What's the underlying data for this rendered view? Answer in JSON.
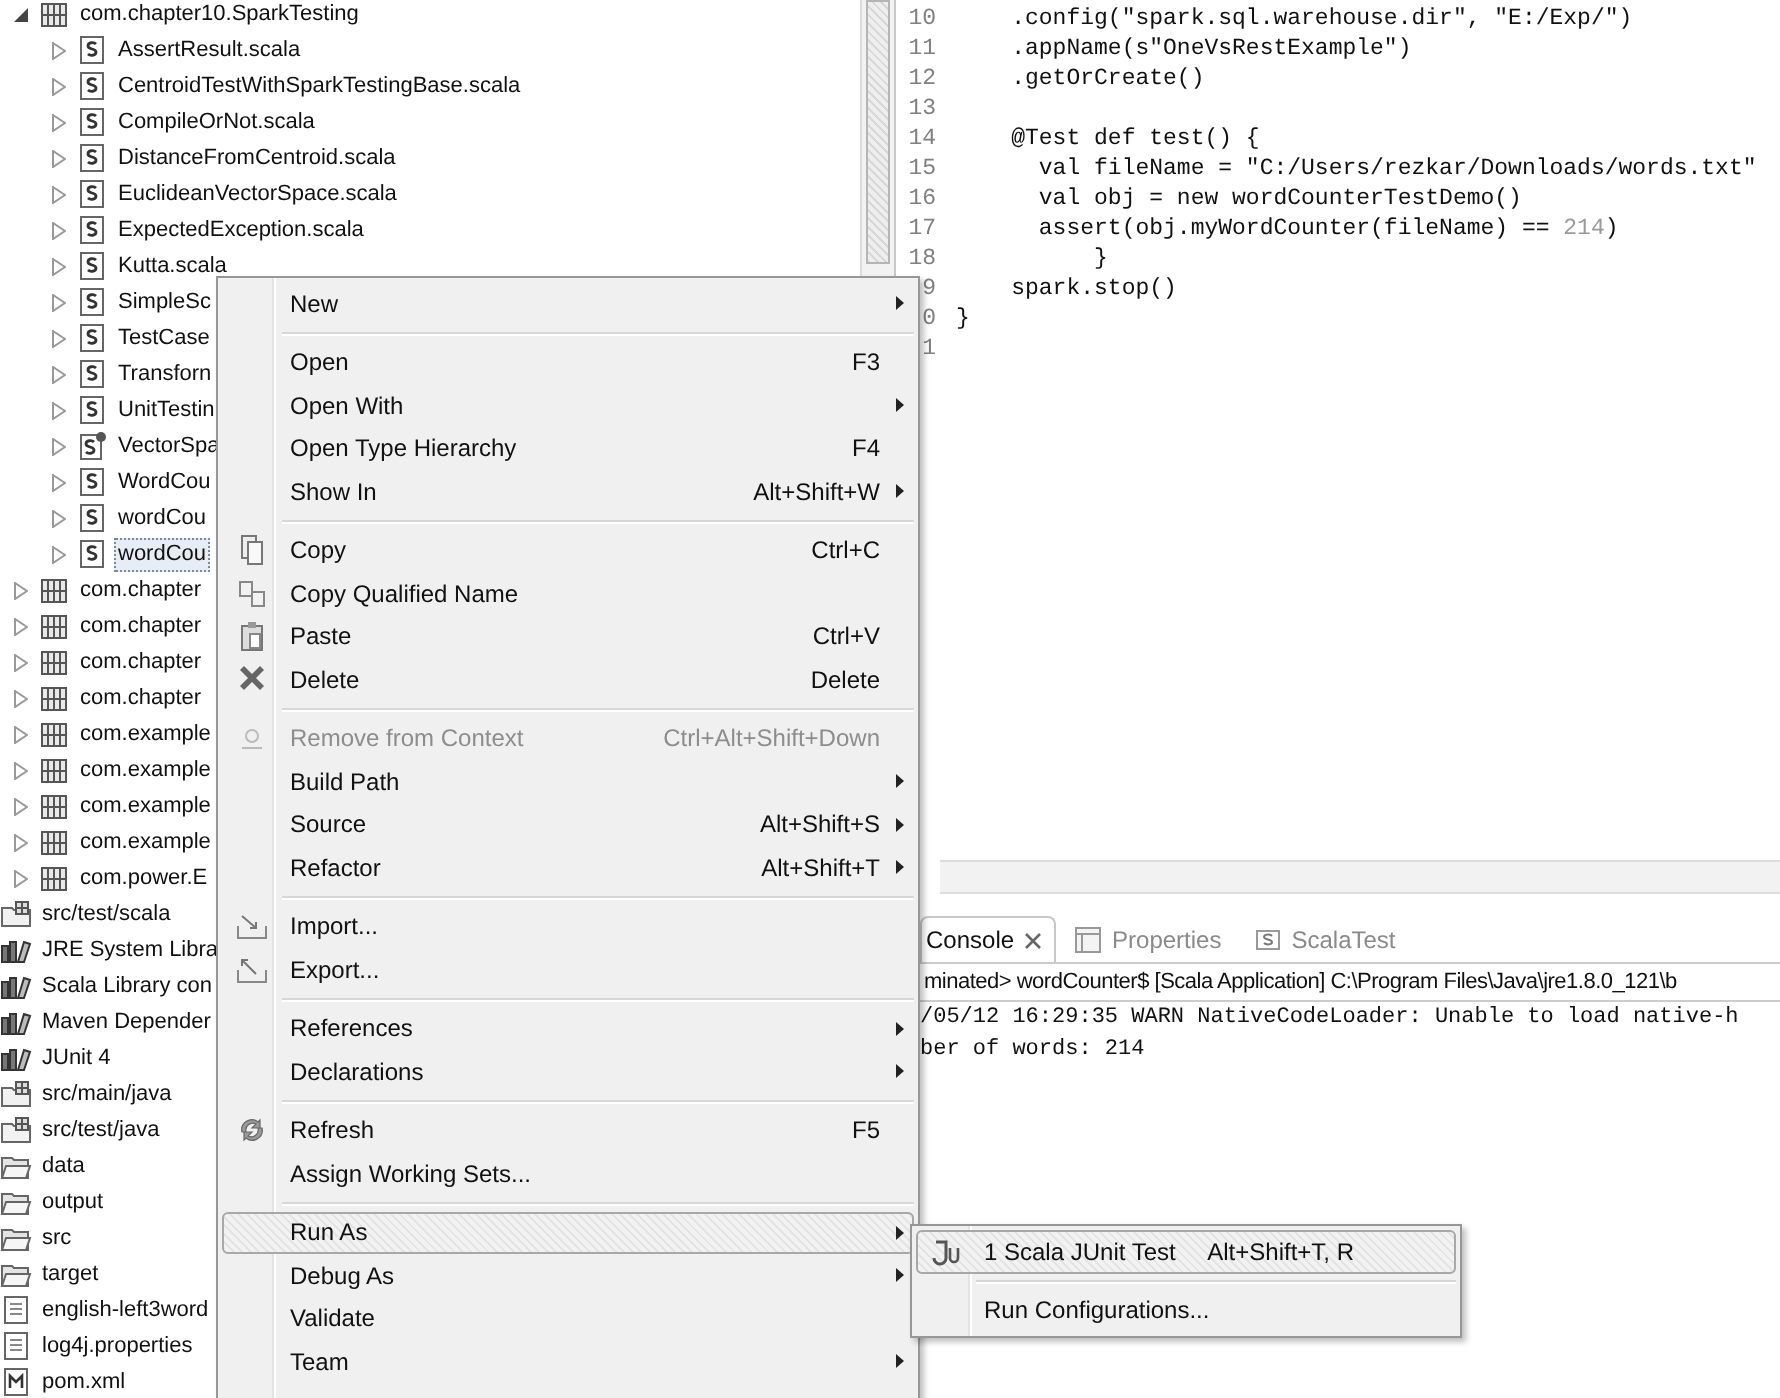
{
  "tree": {
    "upper_items": [
      {
        "label": "com.chapter10.SparkTesting",
        "kind": "package",
        "expanded": true,
        "selected": false,
        "children": [
          {
            "label": "AssertResult.scala",
            "kind": "scala_file",
            "expanded": false,
            "selected": false
          },
          {
            "label": "CentroidTestWithSparkTestingBase.scala",
            "kind": "scala_file",
            "expanded": false,
            "selected": false
          },
          {
            "label": "CompileOrNot.scala",
            "kind": "scala_file",
            "expanded": false,
            "selected": false
          },
          {
            "label": "DistanceFromCentroid.scala",
            "kind": "scala_file",
            "expanded": false,
            "selected": false
          },
          {
            "label": "EuclideanVectorSpace.scala",
            "kind": "scala_file",
            "expanded": false,
            "selected": false
          },
          {
            "label": "ExpectedException.scala",
            "kind": "scala_file",
            "expanded": false,
            "selected": false
          },
          {
            "label": "Kutta.scala",
            "kind": "scala_file",
            "expanded": false,
            "selected": false
          },
          {
            "label": "SimpleSc",
            "kind": "scala_file",
            "expanded": false,
            "selected": false
          },
          {
            "label": "TestCase",
            "kind": "scala_file",
            "expanded": false,
            "selected": false
          },
          {
            "label": "Transforn",
            "kind": "scala_file",
            "expanded": false,
            "selected": false
          },
          {
            "label": "UnitTestin",
            "kind": "scala_file",
            "expanded": false,
            "selected": false
          },
          {
            "label": "VectorSpa",
            "kind": "scala_object",
            "expanded": false,
            "selected": false
          },
          {
            "label": "WordCou",
            "kind": "scala_file",
            "expanded": false,
            "selected": false
          },
          {
            "label": "wordCou",
            "kind": "scala_file",
            "expanded": false,
            "selected": false
          },
          {
            "label": "wordCou",
            "kind": "scala_file",
            "expanded": false,
            "selected": true
          }
        ]
      },
      {
        "label": "com.chapter",
        "kind": "package",
        "expanded": false,
        "selected": false
      },
      {
        "label": "com.chapter",
        "kind": "package",
        "expanded": false,
        "selected": false
      },
      {
        "label": "com.chapter",
        "kind": "package",
        "expanded": false,
        "selected": false
      },
      {
        "label": "com.chapter",
        "kind": "package",
        "expanded": false,
        "selected": false
      },
      {
        "label": "com.example",
        "kind": "package",
        "expanded": false,
        "selected": false
      },
      {
        "label": "com.example",
        "kind": "package",
        "expanded": false,
        "selected": false
      },
      {
        "label": "com.example",
        "kind": "package",
        "expanded": false,
        "selected": false
      },
      {
        "label": "com.example",
        "kind": "package",
        "expanded": false,
        "selected": false
      },
      {
        "label": "com.power.E",
        "kind": "package",
        "expanded": false,
        "selected": false
      }
    ],
    "items": [
      {
        "label": "src/test/scala",
        "kind": "source_folder",
        "selected": false
      },
      {
        "label": "JRE System Libra",
        "kind": "library",
        "selected": false
      },
      {
        "label": "Scala Library con",
        "kind": "library",
        "selected": false
      },
      {
        "label": "Maven Depender",
        "kind": "library",
        "selected": false
      },
      {
        "label": "JUnit 4",
        "kind": "library",
        "selected": false
      },
      {
        "label": "src/main/java",
        "kind": "source_folder",
        "selected": false
      },
      {
        "label": "src/test/java",
        "kind": "source_folder",
        "selected": false
      },
      {
        "label": "data",
        "kind": "folder",
        "selected": false
      },
      {
        "label": "output",
        "kind": "folder",
        "selected": false
      },
      {
        "label": "src",
        "kind": "folder",
        "selected": false
      },
      {
        "label": "target",
        "kind": "folder",
        "selected": false
      },
      {
        "label": "english-left3word",
        "kind": "text_file",
        "selected": false
      },
      {
        "label": "log4j.properties",
        "kind": "text_file",
        "selected": false
      },
      {
        "label": "pom.xml",
        "kind": "xml_file",
        "selected": false
      }
    ]
  },
  "editor": {
    "lines": [
      {
        "number": "10",
        "tokens": [
          {
            "kind": "plain",
            "text": "    .config(\"spark.sql.warehouse.dir\", \"E:/Exp/\")"
          }
        ]
      },
      {
        "number": "11",
        "tokens": [
          {
            "kind": "plain",
            "text": "    .appName(s\"OneVsRestExample\")"
          }
        ]
      },
      {
        "number": "12",
        "tokens": [
          {
            "kind": "plain",
            "text": "    .getOrCreate()"
          }
        ]
      },
      {
        "number": "13"
      },
      {
        "number": "14",
        "tokens": [
          {
            "kind": "plain",
            "text": "    @Test def test() {"
          }
        ]
      },
      {
        "number": "15",
        "tokens": [
          {
            "kind": "plain",
            "text": "      val fileName = \"C:/Users/rezkar/Downloads/words.txt\""
          }
        ]
      },
      {
        "number": "16",
        "tokens": [
          {
            "kind": "plain",
            "text": "      val obj = new wordCounterTestDemo()"
          }
        ]
      },
      {
        "number": "17",
        "tokens": [
          {
            "kind": "plain",
            "text": "      assert(obj.myWordCounter(fileName) == "
          },
          {
            "kind": "number",
            "text": "214"
          },
          {
            "kind": "plain",
            "text": ")"
          }
        ]
      },
      {
        "number": "18",
        "tokens": [
          {
            "kind": "plain",
            "text": "          }"
          }
        ]
      },
      {
        "number": "9",
        "tokens": [
          {
            "kind": "plain",
            "text": "    spark.stop()"
          }
        ]
      },
      {
        "number": "0",
        "tokens": [
          {
            "kind": "plain",
            "text": "}"
          }
        ]
      },
      {
        "number": "1"
      }
    ]
  },
  "console": {
    "tabs": [
      {
        "label": "Console",
        "kind": "console",
        "selected": true
      },
      {
        "label": "Properties",
        "kind": "properties",
        "selected": false
      },
      {
        "label": "ScalaTest",
        "kind": "scalatest",
        "selected": false
      }
    ],
    "header": "minated> wordCounter$ [Scala Application] C:\\Program Files\\Java\\jre1.8.0_121\\b",
    "output": [
      "/05/12 16:29:35 WARN NativeCodeLoader: Unable to load native-h",
      "ber of words: 214"
    ]
  },
  "context_menu": {
    "groups": [
      [
        {
          "label": "New",
          "submenu": true,
          "disabled": false,
          "selected": false
        }
      ],
      [
        {
          "label": "Open",
          "shortcut": "F3",
          "submenu": false,
          "disabled": false,
          "selected": false
        },
        {
          "label": "Open With",
          "submenu": true,
          "disabled": false,
          "selected": false
        },
        {
          "label": "Open Type Hierarchy",
          "shortcut": "F4",
          "submenu": false,
          "disabled": false,
          "selected": false
        },
        {
          "label": "Show In",
          "shortcut": "Alt+Shift+W",
          "submenu": true,
          "disabled": false,
          "selected": false
        }
      ],
      [
        {
          "label": "Copy",
          "shortcut": "Ctrl+C",
          "kind": "copy",
          "submenu": false,
          "disabled": false,
          "selected": false
        },
        {
          "label": "Copy Qualified Name",
          "kind": "copy_name",
          "submenu": false,
          "disabled": false,
          "selected": false
        },
        {
          "label": "Paste",
          "shortcut": "Ctrl+V",
          "kind": "paste",
          "submenu": false,
          "disabled": false,
          "selected": false
        },
        {
          "label": "Delete",
          "shortcut": "Delete",
          "kind": "delete",
          "submenu": false,
          "disabled": false,
          "selected": false
        }
      ],
      [
        {
          "label": "Remove from Context",
          "shortcut": "Ctrl+Alt+Shift+Down",
          "kind": "remove_context",
          "submenu": false,
          "disabled": true,
          "selected": false
        },
        {
          "label": "Build Path",
          "submenu": true,
          "disabled": false,
          "selected": false
        },
        {
          "label": "Source",
          "shortcut": "Alt+Shift+S",
          "submenu": true,
          "disabled": false,
          "selected": false
        },
        {
          "label": "Refactor",
          "shortcut": "Alt+Shift+T",
          "submenu": true,
          "disabled": false,
          "selected": false
        }
      ],
      [
        {
          "label": "Import...",
          "kind": "import",
          "submenu": false,
          "disabled": false,
          "selected": false
        },
        {
          "label": "Export...",
          "kind": "export",
          "submenu": false,
          "disabled": false,
          "selected": false
        }
      ],
      [
        {
          "label": "References",
          "submenu": true,
          "disabled": false,
          "selected": false
        },
        {
          "label": "Declarations",
          "submenu": true,
          "disabled": false,
          "selected": false
        }
      ],
      [
        {
          "label": "Refresh",
          "shortcut": "F5",
          "kind": "refresh",
          "submenu": false,
          "disabled": false,
          "selected": false
        },
        {
          "label": "Assign Working Sets...",
          "submenu": false,
          "disabled": false,
          "selected": false
        }
      ],
      [
        {
          "label": "Run As",
          "submenu": true,
          "disabled": false,
          "selected": true
        },
        {
          "label": "Debug As",
          "submenu": true,
          "disabled": false,
          "selected": false
        },
        {
          "label": "Validate",
          "submenu": false,
          "disabled": false,
          "selected": false
        },
        {
          "label": "Team",
          "submenu": true,
          "disabled": false,
          "selected": false
        }
      ]
    ]
  },
  "run_as_submenu": {
    "groups": [
      [
        {
          "label": "1 Scala JUnit Test",
          "shortcut": "Alt+Shift+T, R",
          "kind": "junit",
          "selected": true
        }
      ],
      [
        {
          "label": "Run Configurations...",
          "selected": false
        }
      ]
    ]
  }
}
